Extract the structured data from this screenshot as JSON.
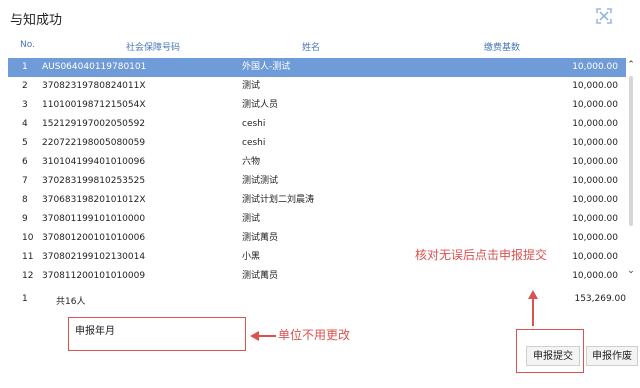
{
  "dialog": {
    "title": "与知成功"
  },
  "table": {
    "columns": {
      "no": "No.",
      "social_id": "社会保障号码",
      "name": "姓名",
      "base": "缴费基数"
    },
    "rows": [
      {
        "no": "1",
        "social_id": "AUS064040119780101",
        "name": "外国人-测试",
        "base": "10,000.00",
        "selected": true
      },
      {
        "no": "2",
        "social_id": "37082319780824011X",
        "name": "测试",
        "base": "10,000.00"
      },
      {
        "no": "3",
        "social_id": "11010019871215054X",
        "name": "测试人员",
        "base": "10,000.00"
      },
      {
        "no": "4",
        "social_id": "152129197002050592",
        "name": "ceshi",
        "base": "10,000.00"
      },
      {
        "no": "5",
        "social_id": "220722198005080059",
        "name": "ceshi",
        "base": "10,000.00"
      },
      {
        "no": "6",
        "social_id": "310104199401010096",
        "name": "六物",
        "base": "10,000.00"
      },
      {
        "no": "7",
        "social_id": "370283199810253525",
        "name": "测试测试",
        "base": "10,000.00"
      },
      {
        "no": "8",
        "social_id": "37068319820101012X",
        "name": "测试计划二刘晨涛",
        "base": "10,000.00"
      },
      {
        "no": "9",
        "social_id": "370801199101010000",
        "name": "测试",
        "base": "10,000.00"
      },
      {
        "no": "10",
        "social_id": "370801200101010006",
        "name": "测试萬员",
        "base": "10,000.00"
      },
      {
        "no": "11",
        "social_id": "370802199102130014",
        "name": "小黑",
        "base": "10,000.00"
      },
      {
        "no": "12",
        "social_id": "370811200101010009",
        "name": "测试萬员",
        "base": "10,000.00"
      }
    ],
    "summary": {
      "no": "1",
      "count": "共16人",
      "total": "153,269.00"
    }
  },
  "form": {
    "month_label": "申报年月",
    "month_value": ""
  },
  "buttons": {
    "submit": "申报提交",
    "void": "申报作废"
  },
  "annotations": {
    "unit_note": "单位不用更改",
    "check_note": "核对无误后点击申报提交",
    "color": "#d9534f"
  },
  "colors": {
    "selected_row": "#6f9bd8",
    "header_text": "#4a78b8"
  },
  "icons": {
    "fullscreen": "fullscreen-icon",
    "scroll_up": "chevron-up-icon",
    "scroll_down": "chevron-down-icon"
  }
}
